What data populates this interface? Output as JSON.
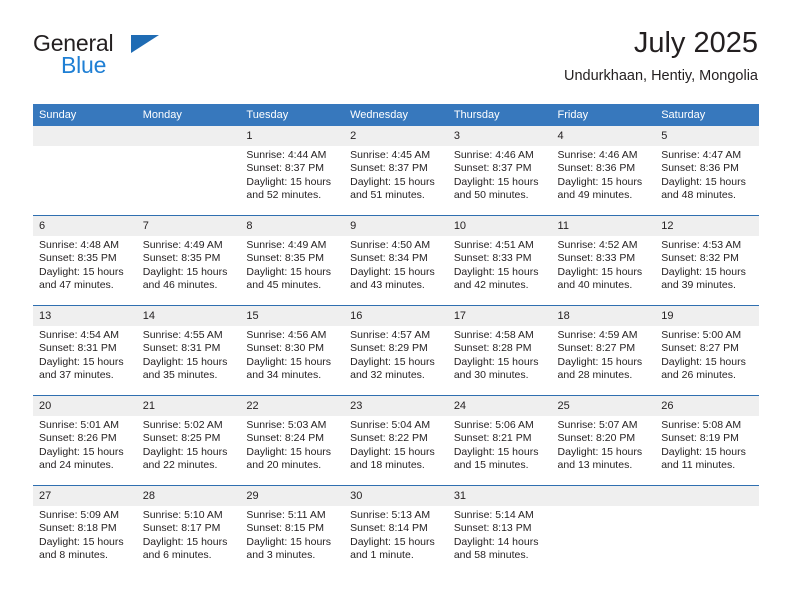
{
  "brand": {
    "name_part1": "General",
    "name_part2": "Blue",
    "triangle_color": "#1f6cb4",
    "blue_color": "#1f7fd4"
  },
  "header": {
    "title": "July 2025",
    "subtitle": "Undurkhaan, Hentiy, Mongolia"
  },
  "theme": {
    "header_bg": "#3778bd",
    "row_divider": "#2f6fb0",
    "daynum_bg": "#efefef",
    "text": "#231f20"
  },
  "calendar": {
    "weekday_headers": [
      "Sunday",
      "Monday",
      "Tuesday",
      "Wednesday",
      "Thursday",
      "Friday",
      "Saturday"
    ],
    "weeks": [
      [
        {
          "day": "",
          "sunrise": "",
          "sunset": "",
          "daylight1": "",
          "daylight2": ""
        },
        {
          "day": "",
          "sunrise": "",
          "sunset": "",
          "daylight1": "",
          "daylight2": ""
        },
        {
          "day": "1",
          "sunrise": "Sunrise: 4:44 AM",
          "sunset": "Sunset: 8:37 PM",
          "daylight1": "Daylight: 15 hours",
          "daylight2": "and 52 minutes."
        },
        {
          "day": "2",
          "sunrise": "Sunrise: 4:45 AM",
          "sunset": "Sunset: 8:37 PM",
          "daylight1": "Daylight: 15 hours",
          "daylight2": "and 51 minutes."
        },
        {
          "day": "3",
          "sunrise": "Sunrise: 4:46 AM",
          "sunset": "Sunset: 8:37 PM",
          "daylight1": "Daylight: 15 hours",
          "daylight2": "and 50 minutes."
        },
        {
          "day": "4",
          "sunrise": "Sunrise: 4:46 AM",
          "sunset": "Sunset: 8:36 PM",
          "daylight1": "Daylight: 15 hours",
          "daylight2": "and 49 minutes."
        },
        {
          "day": "5",
          "sunrise": "Sunrise: 4:47 AM",
          "sunset": "Sunset: 8:36 PM",
          "daylight1": "Daylight: 15 hours",
          "daylight2": "and 48 minutes."
        }
      ],
      [
        {
          "day": "6",
          "sunrise": "Sunrise: 4:48 AM",
          "sunset": "Sunset: 8:35 PM",
          "daylight1": "Daylight: 15 hours",
          "daylight2": "and 47 minutes."
        },
        {
          "day": "7",
          "sunrise": "Sunrise: 4:49 AM",
          "sunset": "Sunset: 8:35 PM",
          "daylight1": "Daylight: 15 hours",
          "daylight2": "and 46 minutes."
        },
        {
          "day": "8",
          "sunrise": "Sunrise: 4:49 AM",
          "sunset": "Sunset: 8:35 PM",
          "daylight1": "Daylight: 15 hours",
          "daylight2": "and 45 minutes."
        },
        {
          "day": "9",
          "sunrise": "Sunrise: 4:50 AM",
          "sunset": "Sunset: 8:34 PM",
          "daylight1": "Daylight: 15 hours",
          "daylight2": "and 43 minutes."
        },
        {
          "day": "10",
          "sunrise": "Sunrise: 4:51 AM",
          "sunset": "Sunset: 8:33 PM",
          "daylight1": "Daylight: 15 hours",
          "daylight2": "and 42 minutes."
        },
        {
          "day": "11",
          "sunrise": "Sunrise: 4:52 AM",
          "sunset": "Sunset: 8:33 PM",
          "daylight1": "Daylight: 15 hours",
          "daylight2": "and 40 minutes."
        },
        {
          "day": "12",
          "sunrise": "Sunrise: 4:53 AM",
          "sunset": "Sunset: 8:32 PM",
          "daylight1": "Daylight: 15 hours",
          "daylight2": "and 39 minutes."
        }
      ],
      [
        {
          "day": "13",
          "sunrise": "Sunrise: 4:54 AM",
          "sunset": "Sunset: 8:31 PM",
          "daylight1": "Daylight: 15 hours",
          "daylight2": "and 37 minutes."
        },
        {
          "day": "14",
          "sunrise": "Sunrise: 4:55 AM",
          "sunset": "Sunset: 8:31 PM",
          "daylight1": "Daylight: 15 hours",
          "daylight2": "and 35 minutes."
        },
        {
          "day": "15",
          "sunrise": "Sunrise: 4:56 AM",
          "sunset": "Sunset: 8:30 PM",
          "daylight1": "Daylight: 15 hours",
          "daylight2": "and 34 minutes."
        },
        {
          "day": "16",
          "sunrise": "Sunrise: 4:57 AM",
          "sunset": "Sunset: 8:29 PM",
          "daylight1": "Daylight: 15 hours",
          "daylight2": "and 32 minutes."
        },
        {
          "day": "17",
          "sunrise": "Sunrise: 4:58 AM",
          "sunset": "Sunset: 8:28 PM",
          "daylight1": "Daylight: 15 hours",
          "daylight2": "and 30 minutes."
        },
        {
          "day": "18",
          "sunrise": "Sunrise: 4:59 AM",
          "sunset": "Sunset: 8:27 PM",
          "daylight1": "Daylight: 15 hours",
          "daylight2": "and 28 minutes."
        },
        {
          "day": "19",
          "sunrise": "Sunrise: 5:00 AM",
          "sunset": "Sunset: 8:27 PM",
          "daylight1": "Daylight: 15 hours",
          "daylight2": "and 26 minutes."
        }
      ],
      [
        {
          "day": "20",
          "sunrise": "Sunrise: 5:01 AM",
          "sunset": "Sunset: 8:26 PM",
          "daylight1": "Daylight: 15 hours",
          "daylight2": "and 24 minutes."
        },
        {
          "day": "21",
          "sunrise": "Sunrise: 5:02 AM",
          "sunset": "Sunset: 8:25 PM",
          "daylight1": "Daylight: 15 hours",
          "daylight2": "and 22 minutes."
        },
        {
          "day": "22",
          "sunrise": "Sunrise: 5:03 AM",
          "sunset": "Sunset: 8:24 PM",
          "daylight1": "Daylight: 15 hours",
          "daylight2": "and 20 minutes."
        },
        {
          "day": "23",
          "sunrise": "Sunrise: 5:04 AM",
          "sunset": "Sunset: 8:22 PM",
          "daylight1": "Daylight: 15 hours",
          "daylight2": "and 18 minutes."
        },
        {
          "day": "24",
          "sunrise": "Sunrise: 5:06 AM",
          "sunset": "Sunset: 8:21 PM",
          "daylight1": "Daylight: 15 hours",
          "daylight2": "and 15 minutes."
        },
        {
          "day": "25",
          "sunrise": "Sunrise: 5:07 AM",
          "sunset": "Sunset: 8:20 PM",
          "daylight1": "Daylight: 15 hours",
          "daylight2": "and 13 minutes."
        },
        {
          "day": "26",
          "sunrise": "Sunrise: 5:08 AM",
          "sunset": "Sunset: 8:19 PM",
          "daylight1": "Daylight: 15 hours",
          "daylight2": "and 11 minutes."
        }
      ],
      [
        {
          "day": "27",
          "sunrise": "Sunrise: 5:09 AM",
          "sunset": "Sunset: 8:18 PM",
          "daylight1": "Daylight: 15 hours",
          "daylight2": "and 8 minutes."
        },
        {
          "day": "28",
          "sunrise": "Sunrise: 5:10 AM",
          "sunset": "Sunset: 8:17 PM",
          "daylight1": "Daylight: 15 hours",
          "daylight2": "and 6 minutes."
        },
        {
          "day": "29",
          "sunrise": "Sunrise: 5:11 AM",
          "sunset": "Sunset: 8:15 PM",
          "daylight1": "Daylight: 15 hours",
          "daylight2": "and 3 minutes."
        },
        {
          "day": "30",
          "sunrise": "Sunrise: 5:13 AM",
          "sunset": "Sunset: 8:14 PM",
          "daylight1": "Daylight: 15 hours",
          "daylight2": "and 1 minute."
        },
        {
          "day": "31",
          "sunrise": "Sunrise: 5:14 AM",
          "sunset": "Sunset: 8:13 PM",
          "daylight1": "Daylight: 14 hours",
          "daylight2": "and 58 minutes."
        },
        {
          "day": "",
          "sunrise": "",
          "sunset": "",
          "daylight1": "",
          "daylight2": ""
        },
        {
          "day": "",
          "sunrise": "",
          "sunset": "",
          "daylight1": "",
          "daylight2": ""
        }
      ]
    ]
  }
}
